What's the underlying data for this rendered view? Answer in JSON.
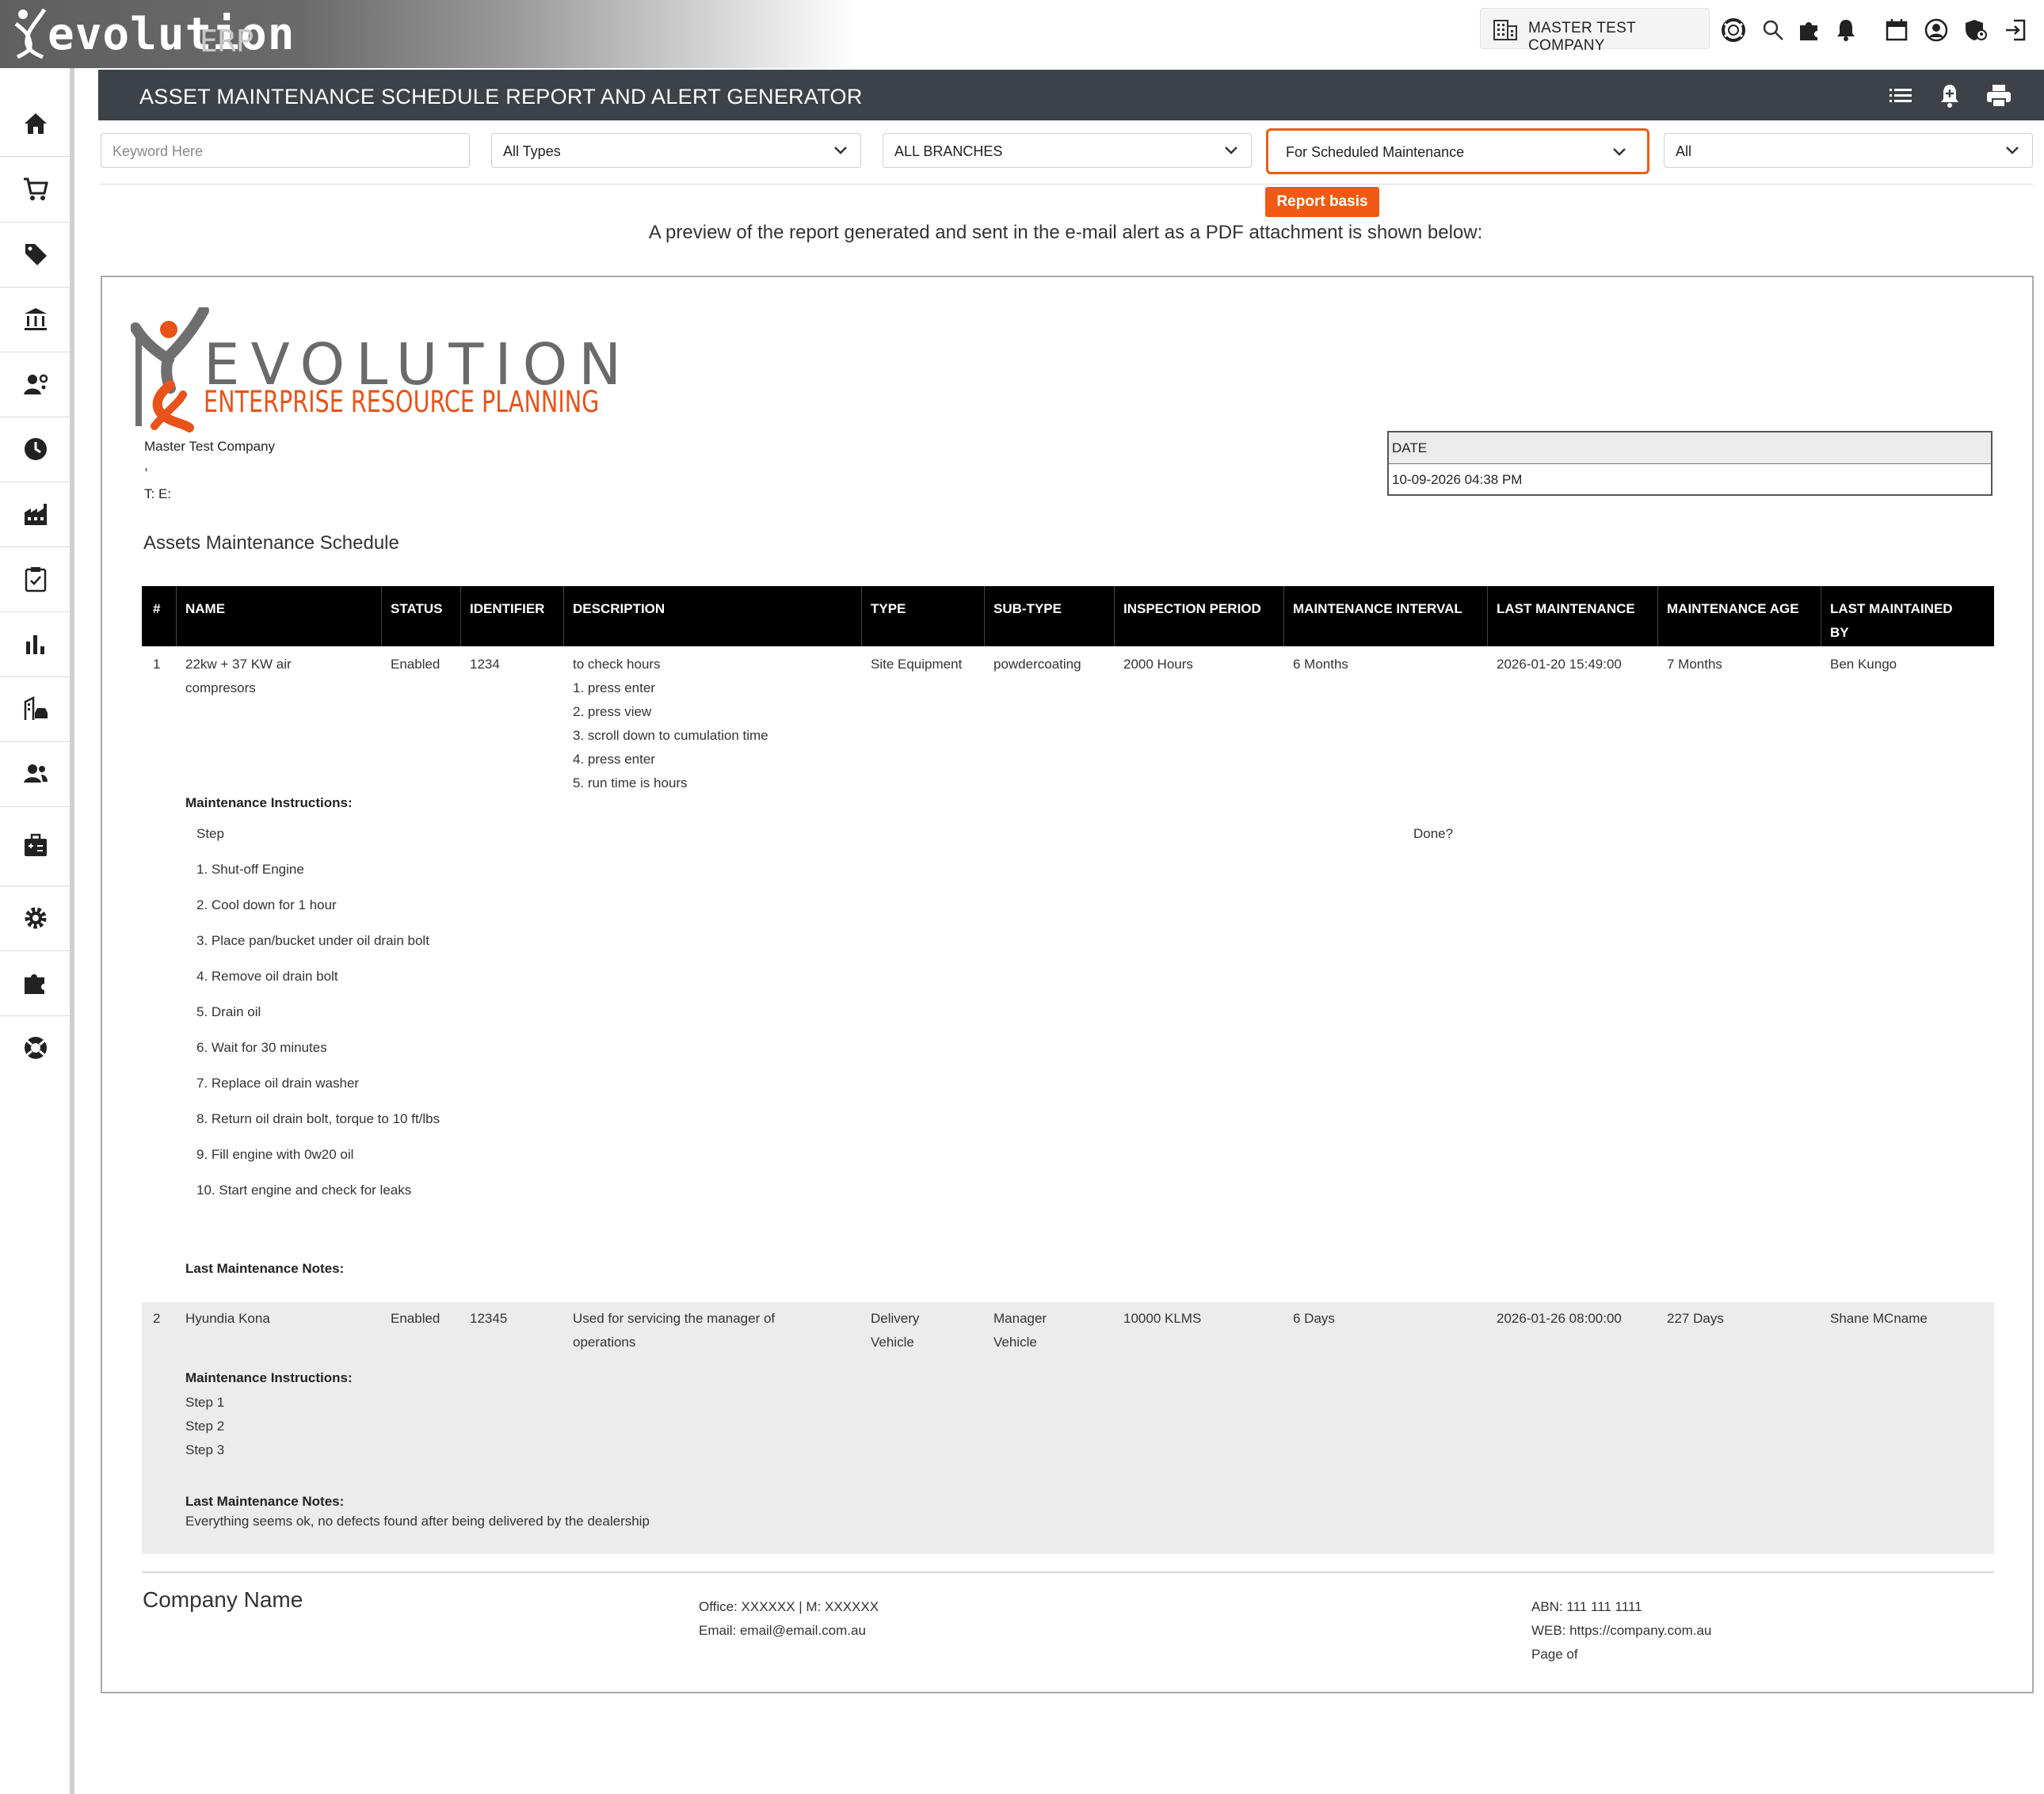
{
  "app": {
    "brand_main": "evolution",
    "brand_sub": "ERP"
  },
  "topbar": {
    "company": "MASTER TEST COMPANY",
    "icons": [
      "building-icon",
      "lifebuoy-icon",
      "search-icon",
      "puzzle-icon",
      "bell-icon",
      "calendar-icon",
      "user-circle-icon",
      "shield-user-icon",
      "logout-icon"
    ]
  },
  "sidebar": {
    "items": [
      "home-icon",
      "cart-icon",
      "tag-icon",
      "bank-icon",
      "user-gear-icon",
      "clock-icon",
      "factory-icon",
      "clipboard-check-icon",
      "bar-chart-icon",
      "building-car-icon",
      "users-icon",
      "calculator-briefcase-icon",
      "gear-icon",
      "puzzle-icon",
      "lifebuoy-icon"
    ]
  },
  "header": {
    "title": "ASSET MAINTENANCE SCHEDULE REPORT AND ALERT GENERATOR",
    "icons": [
      "list-icon",
      "bell-plus-icon",
      "print-icon"
    ]
  },
  "filters": {
    "keyword_placeholder": "Keyword Here",
    "types": "All Types",
    "branches": "ALL BRANCHES",
    "basis": "For Scheduled Maintenance",
    "status": "All",
    "basis_tooltip": "Report basis"
  },
  "preview_caption": "A preview of the report generated and sent in the e-mail alert as a PDF attachment is shown below:",
  "report": {
    "logo_word": "EVOLUTION",
    "logo_sub": "ENTERPRISE RESOURCE PLANNING",
    "company_name": "Master Test Company",
    "company_comma": ",",
    "company_contact": "T: E:",
    "date_label": "DATE",
    "date_value": "10-09-2026 04:38 PM",
    "heading": "Assets Maintenance Schedule",
    "columns": [
      "#",
      "NAME",
      "STATUS",
      "IDENTIFIER",
      "DESCRIPTION",
      "TYPE",
      "SUB-TYPE",
      "INSPECTION PERIOD",
      "MAINTENANCE INTERVAL",
      "LAST MAINTENANCE",
      "MAINTENANCE AGE",
      "LAST MAINTAINED",
      "BY"
    ],
    "row1": {
      "num": "1",
      "name_1": "22kw + 37 KW air",
      "name_2": "compresors",
      "status": "Enabled",
      "identifier": "1234",
      "desc": [
        "to check hours",
        "1. press enter",
        "2. press view",
        "3. scroll down to cumulation time",
        "4. press enter",
        "5. run time is hours"
      ],
      "type": "Site Equipment",
      "subtype": "powdercoating",
      "inspection": "2000 Hours",
      "interval": "6 Months",
      "last": "2026-01-20 15:49:00",
      "age": "7 Months",
      "by": "Ben Kungo",
      "instructions_label": "Maintenance Instructions:",
      "step_header": "Step",
      "done_header": "Done?",
      "steps": [
        "1. Shut-off Engine",
        "2. Cool down for 1 hour",
        "3. Place pan/bucket under oil drain bolt",
        "4. Remove oil drain bolt",
        "5. Drain oil",
        "6. Wait for 30 minutes",
        "7. Replace oil drain washer",
        "8. Return oil drain bolt, torque to 10 ft/lbs",
        "9. Fill engine with 0w20 oil",
        "10. Start engine and check for leaks"
      ],
      "notes_label": "Last Maintenance Notes:"
    },
    "row2": {
      "num": "2",
      "name": "Hyundia Kona",
      "status": "Enabled",
      "identifier": "12345",
      "desc_1": "Used for servicing the manager of",
      "desc_2": "operations",
      "type_1": "Delivery",
      "type_2": "Vehicle",
      "subtype_1": "Manager",
      "subtype_2": "Vehicle",
      "inspection": "10000 KLMS",
      "interval": "6 Days",
      "last": "2026-01-26 08:00:00",
      "age": "227 Days",
      "by": "Shane MCname",
      "instructions_label": "Maintenance Instructions:",
      "steps": [
        "Step 1",
        "Step 2",
        "Step 3"
      ],
      "notes_label": "Last Maintenance Notes:",
      "notes": "Everything seems ok, no defects found after being delivered by the dealership"
    },
    "footer": {
      "company": "Company Name",
      "office": "Office: XXXXXX | M: XXXXXX",
      "email": "Email: email@email.com.au",
      "abn": "ABN: 111 111 1111",
      "web": "WEB: https://company.com.au",
      "page": "Page of"
    }
  },
  "colors": {
    "accent": "#f05a14",
    "header_bar": "#3d4248",
    "table_head": "#000000",
    "row_alt": "#ececec"
  }
}
